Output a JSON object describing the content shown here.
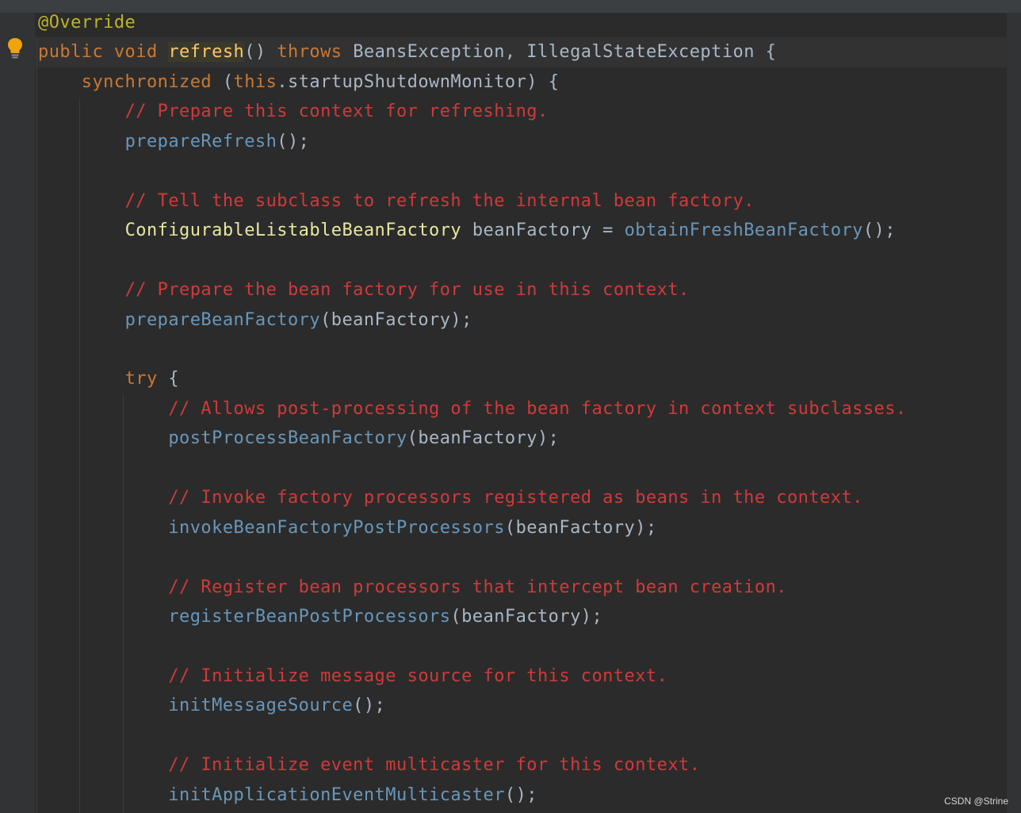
{
  "watermark": "CSDN @Strine",
  "lines": [
    {
      "tokens": [
        {
          "t": "@Override",
          "c": "ann"
        }
      ]
    },
    {
      "tokens": [
        {
          "t": "public void ",
          "c": "kw"
        },
        {
          "t": "refresh",
          "c": "decl"
        },
        {
          "t": "() ",
          "c": "plain"
        },
        {
          "t": "throws ",
          "c": "kw"
        },
        {
          "t": "BeansException, IllegalStateException {",
          "c": "plain"
        }
      ]
    },
    {
      "tokens": [
        {
          "t": "    "
        },
        {
          "t": "synchronized ",
          "c": "kw"
        },
        {
          "t": "(",
          "c": "plain"
        },
        {
          "t": "this",
          "c": "kw"
        },
        {
          "t": ".startupShutdownMonitor) {",
          "c": "plain"
        }
      ]
    },
    {
      "tokens": [
        {
          "t": "        "
        },
        {
          "t": "// Prepare this context for refreshing.",
          "c": "cmt"
        }
      ]
    },
    {
      "tokens": [
        {
          "t": "        "
        },
        {
          "t": "prepareRefresh",
          "c": "call"
        },
        {
          "t": "();",
          "c": "plain"
        }
      ]
    },
    {
      "tokens": []
    },
    {
      "tokens": [
        {
          "t": "        "
        },
        {
          "t": "// Tell the subclass to refresh the internal bean factory.",
          "c": "cmt"
        }
      ]
    },
    {
      "tokens": [
        {
          "t": "        "
        },
        {
          "t": "ConfigurableListableBeanFactory",
          "c": "cls"
        },
        {
          "t": " beanFactory = ",
          "c": "plain"
        },
        {
          "t": "obtainFreshBeanFactory",
          "c": "call"
        },
        {
          "t": "();",
          "c": "plain"
        }
      ]
    },
    {
      "tokens": []
    },
    {
      "tokens": [
        {
          "t": "        "
        },
        {
          "t": "// Prepare the bean factory for use in this context.",
          "c": "cmt"
        }
      ]
    },
    {
      "tokens": [
        {
          "t": "        "
        },
        {
          "t": "prepareBeanFactory",
          "c": "call"
        },
        {
          "t": "(beanFactory);",
          "c": "plain"
        }
      ]
    },
    {
      "tokens": []
    },
    {
      "tokens": [
        {
          "t": "        "
        },
        {
          "t": "try",
          "c": "kw"
        },
        {
          "t": " {",
          "c": "plain"
        }
      ]
    },
    {
      "tokens": [
        {
          "t": "            "
        },
        {
          "t": "// Allows post-processing of the bean factory in context subclasses.",
          "c": "cmt"
        }
      ]
    },
    {
      "tokens": [
        {
          "t": "            "
        },
        {
          "t": "postProcessBeanFactory",
          "c": "call"
        },
        {
          "t": "(beanFactory);",
          "c": "plain"
        }
      ]
    },
    {
      "tokens": []
    },
    {
      "tokens": [
        {
          "t": "            "
        },
        {
          "t": "// Invoke factory processors registered as beans in the context.",
          "c": "cmt"
        }
      ]
    },
    {
      "tokens": [
        {
          "t": "            "
        },
        {
          "t": "invokeBeanFactoryPostProcessors",
          "c": "call"
        },
        {
          "t": "(beanFactory);",
          "c": "plain"
        }
      ]
    },
    {
      "tokens": []
    },
    {
      "tokens": [
        {
          "t": "            "
        },
        {
          "t": "// Register bean processors that intercept bean creation.",
          "c": "cmt"
        }
      ]
    },
    {
      "tokens": [
        {
          "t": "            "
        },
        {
          "t": "registerBeanPostProcessors",
          "c": "call"
        },
        {
          "t": "(beanFactory);",
          "c": "plain"
        }
      ]
    },
    {
      "tokens": []
    },
    {
      "tokens": [
        {
          "t": "            "
        },
        {
          "t": "// Initialize message source for this context.",
          "c": "cmt"
        }
      ]
    },
    {
      "tokens": [
        {
          "t": "            "
        },
        {
          "t": "initMessageSource",
          "c": "call"
        },
        {
          "t": "();",
          "c": "plain"
        }
      ]
    },
    {
      "tokens": []
    },
    {
      "tokens": [
        {
          "t": "            "
        },
        {
          "t": "// Initialize event multicaster for this context.",
          "c": "cmt"
        }
      ]
    },
    {
      "tokens": [
        {
          "t": "            "
        },
        {
          "t": "initApplicationEventMulticaster",
          "c": "call"
        },
        {
          "t": "();",
          "c": "plain"
        }
      ]
    }
  ],
  "icons": {
    "bulb": "lightbulb-icon"
  }
}
